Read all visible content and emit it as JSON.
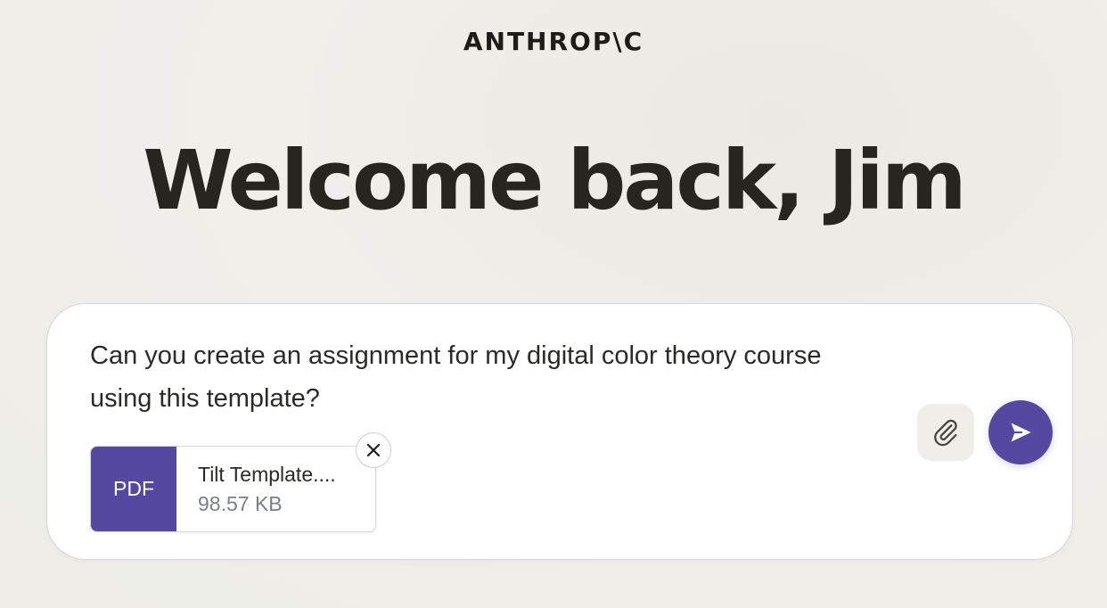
{
  "brand": {
    "logo_text": "ANTHROP\\C"
  },
  "greeting": {
    "text": "Welcome back, Jim"
  },
  "composer": {
    "message": "Can you create an assignment for my digital color theory course using this template?",
    "attachment": {
      "type_label": "PDF",
      "file_name": "Tilt Template....",
      "file_size": "98.57 KB",
      "remove_icon": "close-icon"
    },
    "attach_icon": "paperclip-icon",
    "send_icon": "send-arrow-icon"
  },
  "colors": {
    "accent": "#5548a0",
    "background": "#f0efea",
    "text": "#262520"
  }
}
